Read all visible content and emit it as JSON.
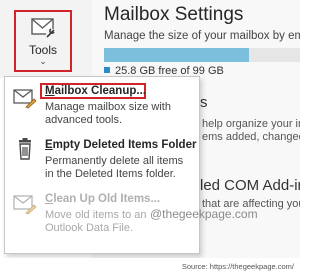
{
  "tools_button": {
    "label": "Tools",
    "chevron": "⌄"
  },
  "settings": {
    "title": "Mailbox Settings",
    "description": "Manage the size of your mailbox by emptying",
    "free_space": "25.8 GB free of 99 GB",
    "quota_used_percent": 74,
    "partial_heading_1": "s",
    "partial_text_1": "help organize your inc",
    "partial_text_2": "ems added, changed, or re",
    "partial_heading_2": "led COM Add-in",
    "partial_text_3": "that are affecting your O"
  },
  "menu": {
    "items": [
      {
        "title_underlined": "M",
        "title_rest": "ailbox Cleanup...",
        "desc_line1": "Manage mailbox size with",
        "desc_line2": "advanced tools.",
        "icon": "mailbox-cleanup-icon",
        "enabled": true
      },
      {
        "title_underlined": "E",
        "title_rest": "mpty Deleted Items Folder",
        "desc_line1": "Permanently delete all items",
        "desc_line2": "in the Deleted Items folder.",
        "icon": "trash-icon",
        "enabled": true
      },
      {
        "title_underlined": "C",
        "title_rest": "lean Up Old Items...",
        "desc_line1": "Move old items to an",
        "desc_line2": "Outlook Data File.",
        "icon": "archive-cleanup-icon",
        "enabled": false
      }
    ]
  },
  "watermark": "@thegeekpage.com",
  "source": "Source: https://thegeekpage.com/",
  "colors": {
    "highlight": "#d2232a",
    "quota_bar": "#7bbfdc",
    "quota_marker": "#2e8bc9"
  }
}
